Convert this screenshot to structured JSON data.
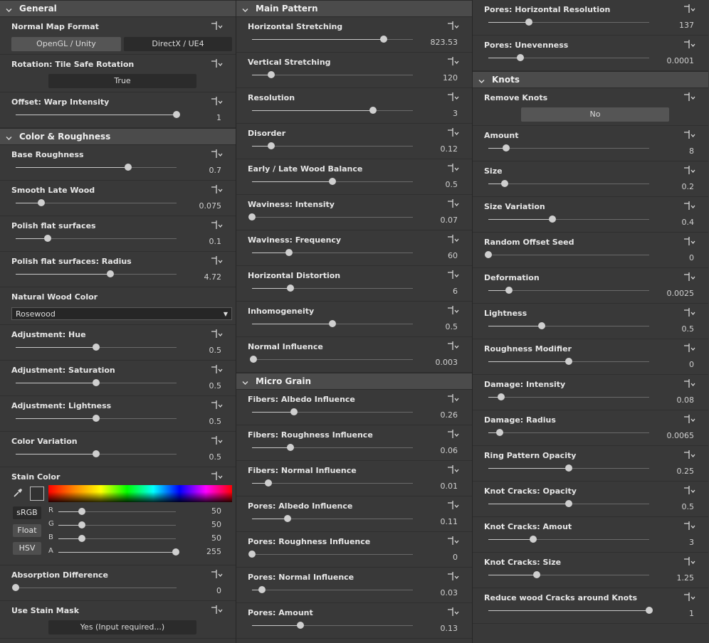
{
  "columns": [
    {
      "items": [
        {
          "kind": "section",
          "title": "General"
        },
        {
          "kind": "buttons",
          "label": "Normal Map Format",
          "options": [
            "OpenGL / Unity",
            "DirectX / UE4"
          ],
          "active": 1
        },
        {
          "kind": "toggle",
          "label": "Rotation: Tile Safe Rotation",
          "value": "True"
        },
        {
          "kind": "slider",
          "label": "Offset: Warp Intensity",
          "value": "1",
          "pos": 1.0
        },
        {
          "kind": "section",
          "title": "Color & Roughness"
        },
        {
          "kind": "slider",
          "label": "Base Roughness",
          "value": "0.7",
          "pos": 0.7
        },
        {
          "kind": "slider",
          "label": "Smooth Late Wood",
          "value": "0.075",
          "pos": 0.16
        },
        {
          "kind": "slider",
          "label": "Polish flat surfaces",
          "value": "0.1",
          "pos": 0.2
        },
        {
          "kind": "slider",
          "label": "Polish flat surfaces: Radius",
          "value": "4.72",
          "pos": 0.59
        },
        {
          "kind": "dropdown",
          "label": "Natural Wood Color",
          "value": "Rosewood"
        },
        {
          "kind": "slider",
          "label": "Adjustment: Hue",
          "value": "0.5",
          "pos": 0.5
        },
        {
          "kind": "slider",
          "label": "Adjustment: Saturation",
          "value": "0.5",
          "pos": 0.5
        },
        {
          "kind": "slider",
          "label": "Adjustment: Lightness",
          "value": "0.5",
          "pos": 0.5
        },
        {
          "kind": "slider",
          "label": "Color Variation",
          "value": "0.5",
          "pos": 0.5
        },
        {
          "kind": "color",
          "label": "Stain Color",
          "modes": [
            "sRGB",
            "Float",
            "HSV"
          ],
          "channels": [
            {
              "name": "R",
              "value": "50",
              "pos": 0.2
            },
            {
              "name": "G",
              "value": "50",
              "pos": 0.2
            },
            {
              "name": "B",
              "value": "50",
              "pos": 0.2
            },
            {
              "name": "A",
              "value": "255",
              "pos": 1.0
            }
          ]
        },
        {
          "kind": "slider",
          "label": "Absorption Difference",
          "value": "0",
          "pos": 0.0
        },
        {
          "kind": "toggle",
          "label": "Use Stain Mask",
          "value": "Yes (Input required...)"
        }
      ]
    },
    {
      "items": [
        {
          "kind": "section",
          "title": "Main Pattern"
        },
        {
          "kind": "slider",
          "label": "Horizontal Stretching",
          "value": "823.53",
          "pos": 0.82
        },
        {
          "kind": "slider",
          "label": "Vertical Stretching",
          "value": "120",
          "pos": 0.12
        },
        {
          "kind": "slider",
          "label": "Resolution",
          "value": "3",
          "pos": 0.75
        },
        {
          "kind": "slider",
          "label": "Disorder",
          "value": "0.12",
          "pos": 0.12
        },
        {
          "kind": "slider",
          "label": "Early / Late Wood Balance",
          "value": "0.5",
          "pos": 0.5
        },
        {
          "kind": "slider",
          "label": "Waviness: Intensity",
          "value": "0.07",
          "pos": 0.0
        },
        {
          "kind": "slider",
          "label": "Waviness: Frequency",
          "value": "60",
          "pos": 0.23
        },
        {
          "kind": "slider",
          "label": "Horizontal Distortion",
          "value": "6",
          "pos": 0.24
        },
        {
          "kind": "slider",
          "label": "Inhomogeneity",
          "value": "0.5",
          "pos": 0.5
        },
        {
          "kind": "slider",
          "label": "Normal Influence",
          "value": "0.003",
          "pos": 0.01
        },
        {
          "kind": "section",
          "title": "Micro Grain"
        },
        {
          "kind": "slider",
          "label": "Fibers: Albedo Influence",
          "value": "0.26",
          "pos": 0.26
        },
        {
          "kind": "slider",
          "label": "Fibers: Roughness Influence",
          "value": "0.06",
          "pos": 0.24
        },
        {
          "kind": "slider",
          "label": "Fibers: Normal Influence",
          "value": "0.01",
          "pos": 0.1
        },
        {
          "kind": "slider",
          "label": "Pores: Albedo Influence",
          "value": "0.11",
          "pos": 0.22
        },
        {
          "kind": "slider",
          "label": "Pores: Roughness Influence",
          "value": "0",
          "pos": 0.0
        },
        {
          "kind": "slider",
          "label": "Pores: Normal Influence",
          "value": "0.03",
          "pos": 0.06
        },
        {
          "kind": "slider",
          "label": "Pores: Amount",
          "value": "0.13",
          "pos": 0.3
        }
      ]
    },
    {
      "items": [
        {
          "kind": "slider",
          "label": "Pores: Horizontal Resolution",
          "value": "137",
          "pos": 0.25
        },
        {
          "kind": "slider",
          "label": "Pores: Unevenness",
          "value": "0.0001",
          "pos": 0.2
        },
        {
          "kind": "section",
          "title": "Knots"
        },
        {
          "kind": "toggle",
          "label": "Remove Knots",
          "value": "No"
        },
        {
          "kind": "slider",
          "label": "Amount",
          "value": "8",
          "pos": 0.11
        },
        {
          "kind": "slider",
          "label": "Size",
          "value": "0.2",
          "pos": 0.1
        },
        {
          "kind": "slider",
          "label": "Size Variation",
          "value": "0.4",
          "pos": 0.4
        },
        {
          "kind": "slider",
          "label": "Random Offset Seed",
          "value": "0",
          "pos": 0.0
        },
        {
          "kind": "slider",
          "label": "Deformation",
          "value": "0.0025",
          "pos": 0.13
        },
        {
          "kind": "slider",
          "label": "Lightness",
          "value": "0.5",
          "pos": 0.33
        },
        {
          "kind": "slider",
          "label": "Roughness Modifier",
          "value": "0",
          "pos": 0.5
        },
        {
          "kind": "slider",
          "label": "Damage: Intensity",
          "value": "0.08",
          "pos": 0.08
        },
        {
          "kind": "slider",
          "label": "Damage: Radius",
          "value": "0.0065",
          "pos": 0.07
        },
        {
          "kind": "slider",
          "label": "Ring Pattern Opacity",
          "value": "0.25",
          "pos": 0.5
        },
        {
          "kind": "slider",
          "label": "Knot Cracks: Opacity",
          "value": "0.5",
          "pos": 0.5
        },
        {
          "kind": "slider",
          "label": "Knot Cracks: Amout",
          "value": "3",
          "pos": 0.28
        },
        {
          "kind": "slider",
          "label": "Knot Cracks: Size",
          "value": "1.25",
          "pos": 0.3
        },
        {
          "kind": "slider",
          "label": "Reduce wood Cracks around Knots",
          "value": "1",
          "pos": 1.0
        }
      ]
    }
  ],
  "colors": {
    "panel": "#393939",
    "section": "#4b4b4b",
    "knob": "#cfcfcf",
    "swatch": "#323232"
  }
}
